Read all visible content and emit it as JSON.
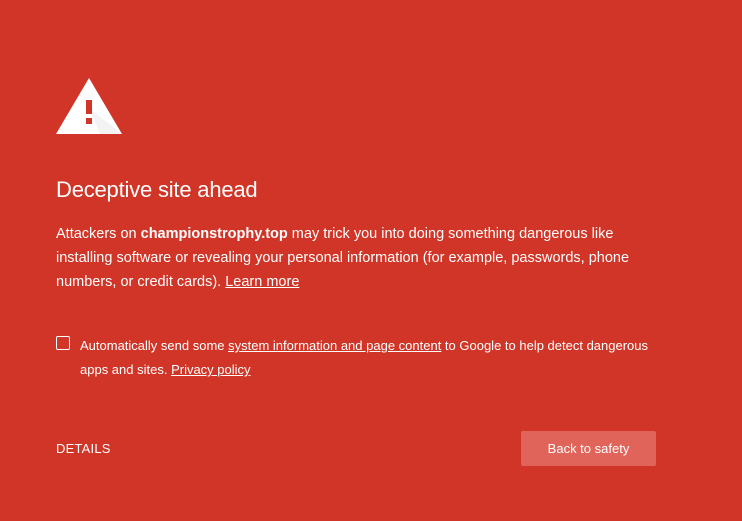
{
  "title": "Deceptive site ahead",
  "message": {
    "prefix": "Attackers on ",
    "domain": "championstrophy.top",
    "suffix": " may trick you into doing something dangerous like installing software or revealing your personal information (for example, passwords, phone numbers, or credit cards). ",
    "learn_more": "Learn more"
  },
  "extended_reporting": {
    "checked": false,
    "prefix": "Automatically send some ",
    "link_text": "system information and page content",
    "middle": " to Google to help detect dangerous apps and sites. ",
    "privacy_link": "Privacy policy"
  },
  "details_label": "DETAILS",
  "primary_button_label": "Back to safety",
  "icon": "warning-triangle-icon",
  "colors": {
    "background": "#d03527",
    "button": "#e0645a",
    "text": "#ffffff"
  }
}
